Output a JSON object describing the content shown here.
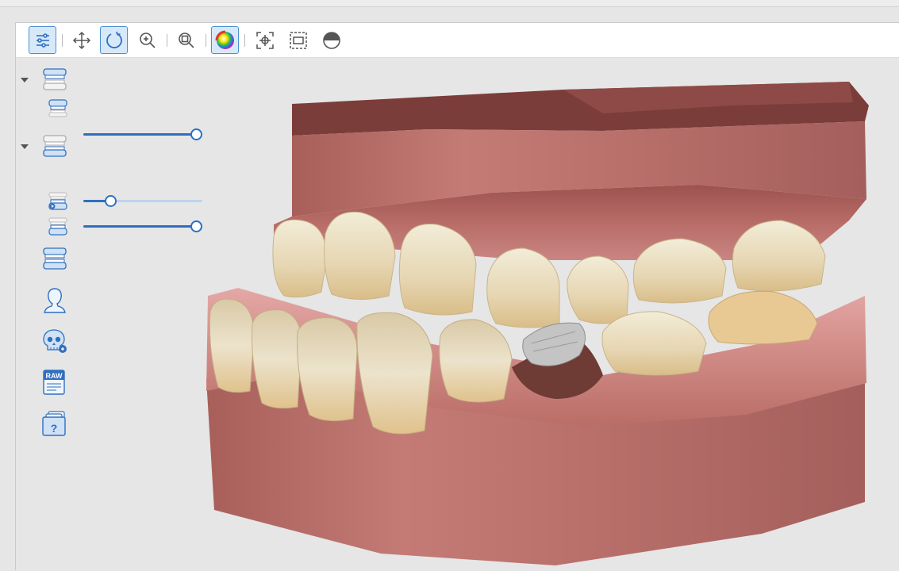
{
  "toolbar": {
    "buttons": [
      {
        "name": "settings-sliders-icon",
        "active": true
      },
      {
        "name": "pan-move-icon",
        "active": false
      },
      {
        "name": "rotate-icon",
        "active": true
      },
      {
        "name": "zoom-in-icon",
        "active": false
      },
      {
        "name": "zoom-fit-icon",
        "active": false
      },
      {
        "name": "color-texture-icon",
        "active": true
      },
      {
        "name": "center-target-icon",
        "active": false
      },
      {
        "name": "section-box-icon",
        "active": false
      },
      {
        "name": "half-circle-contrast-icon",
        "active": false
      }
    ]
  },
  "sidebar": {
    "groups": [
      {
        "name": "upper-jaw-group",
        "expanded": true
      },
      {
        "name": "lower-jaw-group",
        "expanded": true
      }
    ],
    "sliders": {
      "upper_opacity": 1.0,
      "lower_scan_opacity": 0.2,
      "lower_opacity": 1.0
    },
    "raw_label": "RAW",
    "help_label": "?"
  },
  "colors": {
    "accent": "#2f6fc0",
    "accent_light": "#d7e9f8",
    "gum": "#c9817d",
    "tooth": "#e9dcc0",
    "background": "#e6e6e6"
  }
}
